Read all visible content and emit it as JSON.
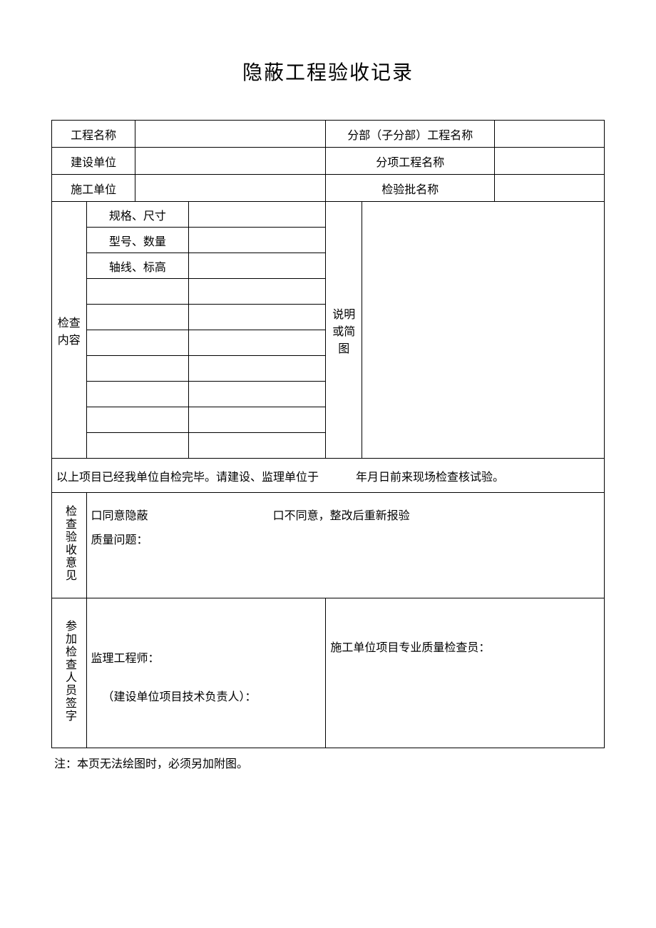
{
  "title": "隐蔽工程验收记录",
  "header": {
    "project_name_label": "工程名称",
    "project_name_value": "",
    "sub_branch_label": "分部（子分部）工程名称",
    "sub_branch_value": "",
    "construction_unit_label": "建设单位",
    "construction_unit_value": "",
    "sub_item_label": "分项工程名称",
    "sub_item_value": "",
    "contractor_label": "施工单位",
    "contractor_value": "",
    "inspection_batch_label": "检验批名称",
    "inspection_batch_value": ""
  },
  "check": {
    "label_l1": "检查",
    "label_l2": "内容",
    "rows": [
      "规格、尺寸",
      "型号、数量",
      "轴线、标高",
      "",
      "",
      "",
      "",
      "",
      "",
      ""
    ],
    "desc_label_l1": "说明",
    "desc_label_l2": "或简",
    "desc_label_l3": "图",
    "desc_value": ""
  },
  "note": {
    "part1": "以上项目已经我单位自检完毕。请建设、监理单位于",
    "part2": "年月日前来现场检查核试验。"
  },
  "opinion": {
    "label": "检查验收意见",
    "agree": "口同意隐蔽",
    "disagree": "口不同意，整改后重新报验",
    "quality": "质量问题：",
    "quality_value": ""
  },
  "signature": {
    "label": "参加检查人员签字",
    "supervisor": "监理工程师：",
    "owner_tech": "（建设单位项目技术负责人）：",
    "contractor_qc": "施工单位项目专业质量检查员："
  },
  "footnote": "注：本页无法绘图时，必须另加附图。"
}
